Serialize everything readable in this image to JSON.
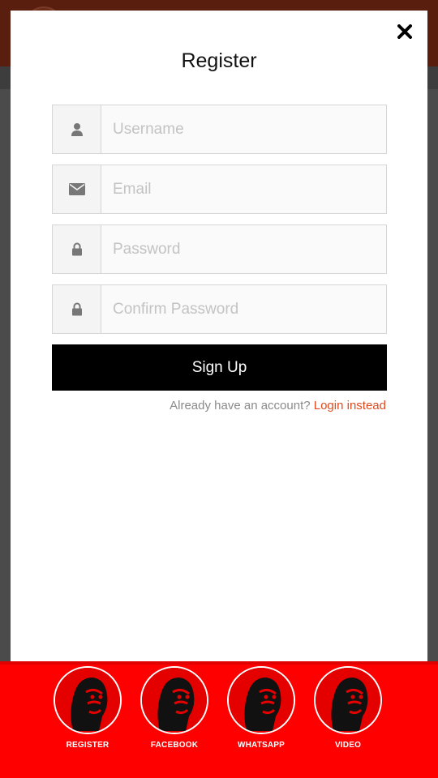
{
  "modal": {
    "title": "Register",
    "close_icon": "close-icon",
    "fields": [
      {
        "placeholder": "Username",
        "icon": "user-icon"
      },
      {
        "placeholder": "Email",
        "icon": "envelope-icon"
      },
      {
        "placeholder": "Password",
        "icon": "lock-icon"
      },
      {
        "placeholder": "Confirm Password",
        "icon": "lock-icon"
      }
    ],
    "signup_label": "Sign Up",
    "login_prompt": "Already have an account?",
    "login_link": "Login instead"
  },
  "bottom_nav": {
    "items": [
      {
        "label": "REGISTER"
      },
      {
        "label": "FACEBOOK"
      },
      {
        "label": "WHATSAPP"
      },
      {
        "label": "VIDEO"
      }
    ]
  },
  "colors": {
    "accent_link": "#e04a1f",
    "bottom_bar": "#ff0000",
    "button": "#000000"
  }
}
